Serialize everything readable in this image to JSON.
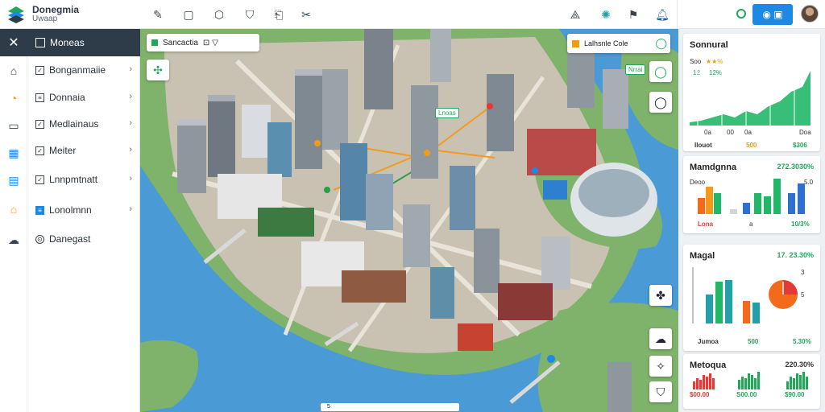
{
  "app": {
    "title": "Donegmia",
    "subtitle": "Uwaap"
  },
  "sidebar": {
    "header_label": "Moneas",
    "items": [
      {
        "label": "Bonganmaiie",
        "icon": "home-icon"
      },
      {
        "label": "Donnaia",
        "icon": "note-icon"
      },
      {
        "label": "Medlainaus",
        "icon": "chart-icon"
      },
      {
        "label": "Meiter",
        "icon": "pencil-icon"
      },
      {
        "label": "Lnnpmtnatt",
        "icon": "grid-icon"
      },
      {
        "label": "Lonolmnn",
        "icon": "document-icon"
      },
      {
        "label": "Danegast",
        "icon": "cloud-icon"
      }
    ]
  },
  "map": {
    "search_label": "Sancactia",
    "legend_text": "Lalhsnle Cole",
    "label_1": "Lnoas",
    "label_2": "Nrrai",
    "bottom_text": "5"
  },
  "panel": {
    "card1": {
      "title": "Sonnural",
      "row1_label": "Soo",
      "row2_left": "12",
      "row2_right": "12%",
      "axis_left": "0a",
      "axis_mid1": "00",
      "axis_mid2": "0a",
      "axis_right": "Doa",
      "foot_left": "Ilouot",
      "foot_mid": "500",
      "foot_right": "$306"
    },
    "card2": {
      "title": "Mamdgnna",
      "value": "272.3030%",
      "sub_left": "Deoo",
      "sub_right": "5.0",
      "foot_left": "Lona",
      "foot_mid": "a",
      "foot_right": "10/3%"
    },
    "card3": {
      "title": "Magal",
      "value": "17. 23.30%",
      "foot_left": "Jumoa",
      "foot_mid": "500",
      "foot_right": "5.30%"
    },
    "card4": {
      "title": "Metoqua",
      "value": "220.30%",
      "foot_left": "$00.00",
      "foot_mid": "S00.00",
      "foot_right": "$90.00"
    }
  },
  "colors": {
    "accent": "#1e88e5",
    "sidebar_header": "#2e3b48",
    "green": "#21a65a",
    "orange": "#f29a1a",
    "water": "#4a9ad6"
  }
}
